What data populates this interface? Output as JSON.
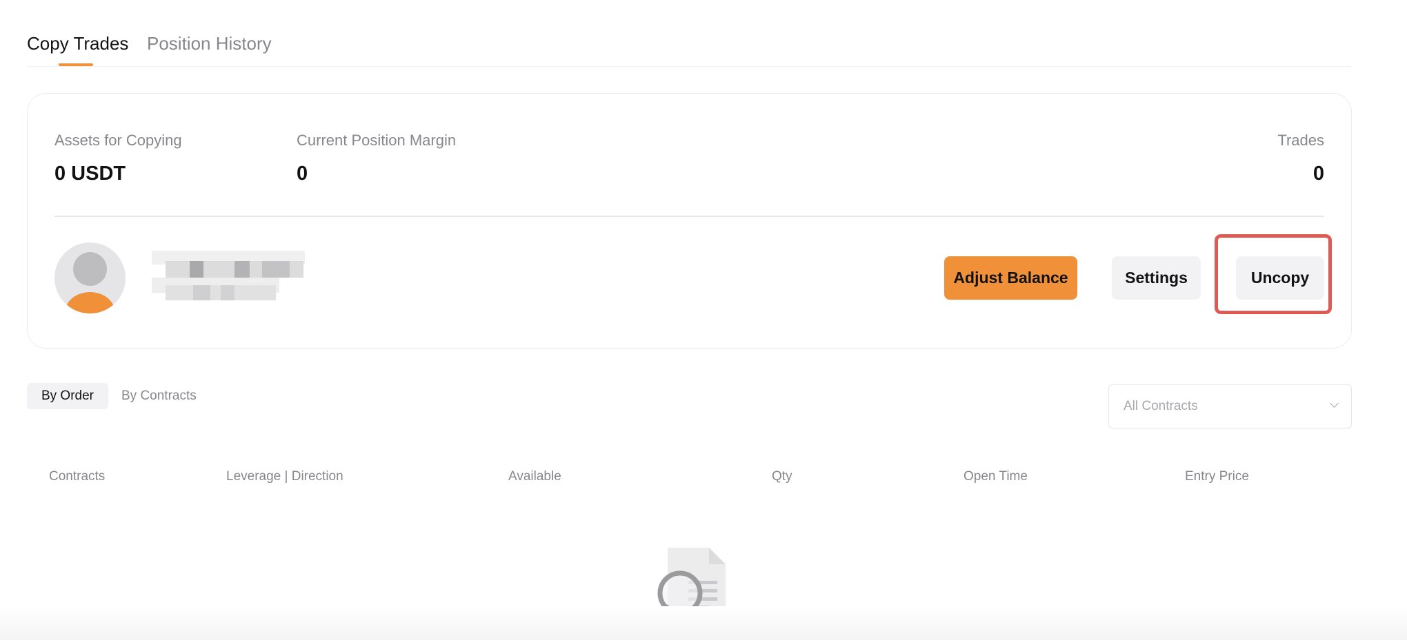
{
  "tabs": {
    "copy_trades": "Copy Trades",
    "position_history": "Position History"
  },
  "summary": {
    "assets_label": "Assets for Copying",
    "assets_value": "0 USDT",
    "margin_label": "Current Position Margin",
    "margin_value": "0",
    "trades_label": "Trades",
    "trades_value": "0"
  },
  "trader": {
    "buttons": {
      "adjust_balance": "Adjust Balance",
      "settings": "Settings",
      "uncopy": "Uncopy"
    }
  },
  "filters": {
    "by_order": "By Order",
    "by_contracts": "By Contracts",
    "contract_select": "All Contracts"
  },
  "table": {
    "columns": [
      "Contracts",
      "Leverage | Direction",
      "Available",
      "Qty",
      "Open Time",
      "Entry Price"
    ]
  },
  "colors": {
    "accent": "#f0913a",
    "highlight": "#e05a55"
  },
  "icons": [
    "chevron-down-icon",
    "empty-search-icon",
    "avatar-icon"
  ]
}
